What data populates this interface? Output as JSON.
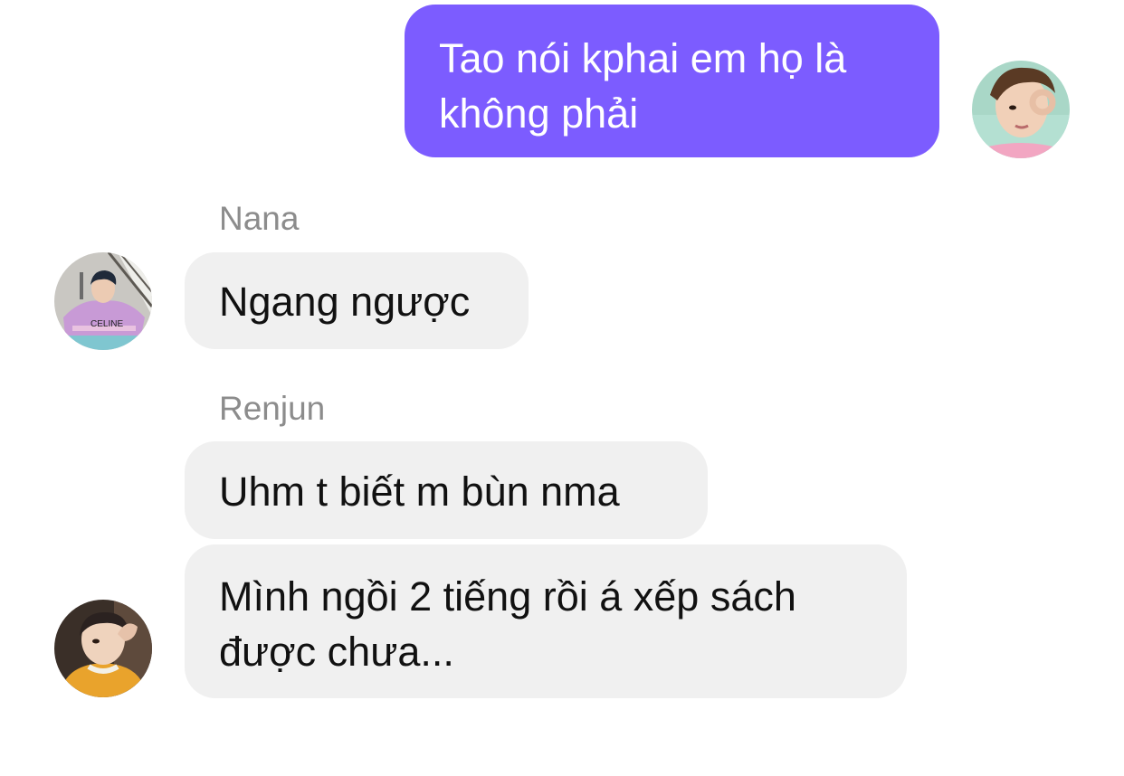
{
  "messages": [
    {
      "sender": "",
      "direction": "outgoing",
      "text": "Tao nói kphai em họ là không phải"
    },
    {
      "sender": "Nana",
      "direction": "incoming",
      "text": "Ngang ngược"
    },
    {
      "sender": "Renjun",
      "direction": "incoming",
      "text": "Uhm t biết m bùn nma"
    },
    {
      "sender": "Renjun",
      "direction": "incoming",
      "text": "Mình ngồi 2 tiếng rồi á xếp sách được chưa..."
    }
  ],
  "avatars": {
    "self": {
      "shirt_text": ""
    },
    "nana": {
      "shirt_text": "CELINE"
    },
    "renjun": {
      "shirt_text": ""
    }
  },
  "colors": {
    "outgoing_bubble": "#7c5cff",
    "incoming_bubble": "#f0f0f0",
    "sender_name": "#8c8c8c",
    "background": "#ffffff"
  }
}
